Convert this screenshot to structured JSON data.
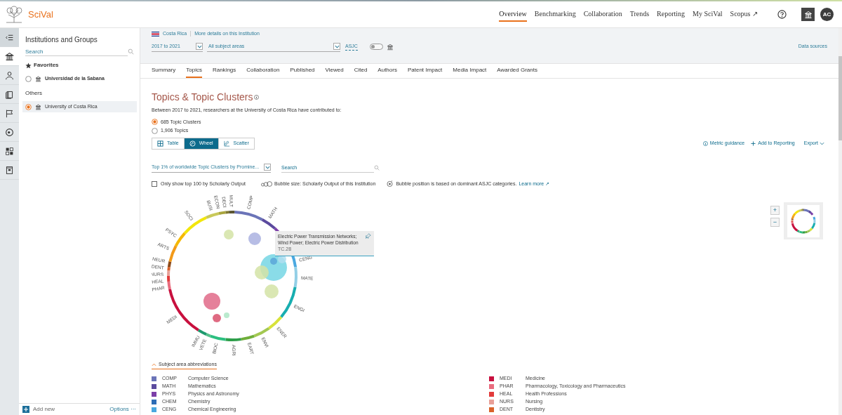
{
  "app": {
    "name": "SciVal"
  },
  "nav": [
    {
      "label": "Overview",
      "selected": true
    },
    {
      "label": "Benchmarking",
      "selected": false
    },
    {
      "label": "Collaboration",
      "selected": false
    },
    {
      "label": "Trends",
      "selected": false
    },
    {
      "label": "Reporting",
      "selected": false
    },
    {
      "label": "My SciVal",
      "selected": false
    },
    {
      "label": "Scopus ↗",
      "selected": false
    }
  ],
  "user": {
    "initials": "AC"
  },
  "rail": [
    {
      "kind": "collapse",
      "selected": false
    },
    {
      "kind": "institution",
      "selected": true
    },
    {
      "kind": "person",
      "selected": false
    },
    {
      "kind": "book",
      "selected": false
    },
    {
      "kind": "flag",
      "selected": false
    },
    {
      "kind": "target",
      "selected": false
    },
    {
      "kind": "grid",
      "selected": false
    },
    {
      "kind": "document",
      "selected": false
    }
  ],
  "sidebar": {
    "title": "Institutions and Groups",
    "search": {
      "placeholder": "Search"
    },
    "favorites": {
      "label": "Favorites",
      "items": [
        {
          "label": "Universidad de la Sabana",
          "selected": false
        }
      ]
    },
    "others": {
      "label": "Others",
      "items": [
        {
          "label": "University of Costa Rica",
          "selected": true
        }
      ]
    },
    "add_new": "Add new",
    "options": "Options ···"
  },
  "filters": {
    "country": "Costa Rica",
    "details_link": "More details on this Institution",
    "years": "2017 to 2021",
    "subject": "All subject areas",
    "asjc": "ASJC",
    "asjc_toggle_on": false,
    "data_sources": "Data sources"
  },
  "tabs": [
    {
      "label": "Summary",
      "selected": false
    },
    {
      "label": "Topics",
      "selected": true
    },
    {
      "label": "Rankings",
      "selected": false
    },
    {
      "label": "Collaboration",
      "selected": false
    },
    {
      "label": "Published",
      "selected": false
    },
    {
      "label": "Viewed",
      "selected": false
    },
    {
      "label": "Cited",
      "selected": false
    },
    {
      "label": "Authors",
      "selected": false
    },
    {
      "label": "Patent Impact",
      "selected": false
    },
    {
      "label": "Media Impact",
      "selected": false
    },
    {
      "label": "Awarded Grants",
      "selected": false
    }
  ],
  "content": {
    "title": "Topics & Topic Clusters",
    "intro": "Between 2017 to 2021, researchers at the University of Costa Rica have contributed to:",
    "scope": [
      {
        "label": "685 Topic Clusters",
        "selected": true
      },
      {
        "label": "1,906 Topics",
        "selected": false
      }
    ],
    "views": [
      {
        "label": "Table",
        "kind": "table",
        "selected": false
      },
      {
        "label": "Wheel",
        "kind": "wheel",
        "selected": true
      },
      {
        "label": "Scatter",
        "kind": "scatter",
        "selected": false
      }
    ],
    "actions": {
      "metric_guidance": "Metric guidance",
      "add_to_reporting": "Add to Reporting",
      "export": "Export"
    },
    "cluster_filter": "Top 1% of worldwide Topic Clusters by Promine...",
    "search": {
      "placeholder": "Search"
    },
    "top100": {
      "label": "Only show top 100 by Scholarly Output",
      "checked": false
    },
    "bubble_size": "Bubble size: Scholarly Output of this Institution",
    "bubble_position": "Bubble position is based on dominant ASJC categories.",
    "learn_more": "Learn more ↗"
  },
  "wheel": {
    "segments": [
      {
        "label": "COMP",
        "color": "#6b74b8"
      },
      {
        "label": "MATH",
        "color": "#5b4a9e"
      },
      {
        "color": "#7c3fa8"
      },
      {
        "label": "CENG",
        "color": "#4aa8e0"
      },
      {
        "label": "MATE",
        "color": "#93cfe6"
      },
      {
        "label": "ENGI",
        "color": "#18aeb0"
      },
      {
        "label": "ENER",
        "color": "#d7e23a"
      },
      {
        "label": "ENVI",
        "color": "#a3c852"
      },
      {
        "label": "EART",
        "color": "#6fae3a"
      },
      {
        "label": "AGRI",
        "color": "#2e9e4a"
      },
      {
        "label": "BIOC",
        "color": "#2cbf80"
      },
      {
        "label": "VETE",
        "color": "#55c08a"
      },
      {
        "label": "IMMU",
        "color": "#1e9a6e"
      },
      {
        "label": "MEDI",
        "color": "#c8103e"
      },
      {
        "label": "PHAR",
        "color": "#e96c7e"
      },
      {
        "label": "HEAL",
        "color": "#e23b3b"
      },
      {
        "label": "NURS",
        "color": "#e8a098"
      },
      {
        "label": "DENT",
        "color": "#d9622a"
      },
      {
        "label": "NEUR",
        "color": "#8b4a1a"
      },
      {
        "label": "ARTS",
        "color": "#f29a1a"
      },
      {
        "label": "PSYC",
        "color": "#f5b800"
      },
      {
        "label": "SOCI",
        "color": "#f2e60c"
      },
      {
        "label": "BUSI",
        "color": "#c9c95a"
      },
      {
        "label": "ECON",
        "color": "#a9a53e"
      },
      {
        "label": "DECI",
        "color": "#807a30"
      },
      {
        "label": "MULT",
        "color": "#5a5530"
      }
    ],
    "tooltip": {
      "title": "Electric Power Transmission Networks; Wind Power; Electric Power Distribution",
      "code": "TC.28"
    },
    "zoom_in": "+",
    "zoom_out": "−"
  },
  "legend": {
    "toggle": "Subject area abbreviations",
    "expanded": true,
    "left": [
      {
        "code": "COMP",
        "name": "Computer Science",
        "color": "#6b74b8"
      },
      {
        "code": "MATH",
        "name": "Mathematics",
        "color": "#5b4a9e"
      },
      {
        "code": "PHYS",
        "name": "Physics and Astronomy",
        "color": "#7c3fa8"
      },
      {
        "code": "CHEM",
        "name": "Chemistry",
        "color": "#2e6db6"
      },
      {
        "code": "CENG",
        "name": "Chemical Engineering",
        "color": "#4aa8e0"
      }
    ],
    "right": [
      {
        "code": "MEDI",
        "name": "Medicine",
        "color": "#c8103e"
      },
      {
        "code": "PHAR",
        "name": "Pharmacology, Toxicology and Pharmaceutics",
        "color": "#e96c7e"
      },
      {
        "code": "HEAL",
        "name": "Health Professions",
        "color": "#e23b3b"
      },
      {
        "code": "NURS",
        "name": "Nursing",
        "color": "#e8a098"
      },
      {
        "code": "DENT",
        "name": "Dentistry",
        "color": "#d9622a"
      }
    ]
  }
}
